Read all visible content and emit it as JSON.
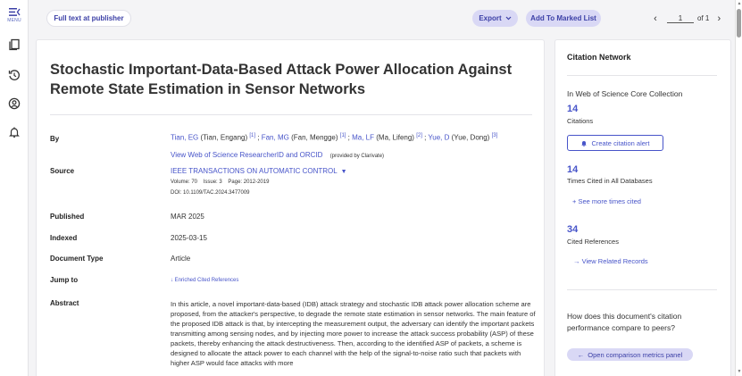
{
  "rail": {
    "menu_label": "MENU"
  },
  "toolbar": {
    "full_text_label": "Full text at publisher",
    "export_label": "Export",
    "marked_list_label": "Add To Marked List",
    "page_current": "1",
    "page_total": "of 1"
  },
  "record": {
    "title": "Stochastic Important-Data-Based Attack Power Allocation Against Remote State Estimation in Sensor Networks",
    "labels": {
      "by": "By",
      "source": "Source",
      "published": "Published",
      "indexed": "Indexed",
      "document_type": "Document Type",
      "jump_to": "Jump to",
      "abstract": "Abstract"
    },
    "authors": [
      {
        "short": "Tian, EG",
        "full": "(Tian, Engang)",
        "ref": "[1]"
      },
      {
        "short": "Fan, MG",
        "full": "(Fan, Mengge)",
        "ref": "[1]"
      },
      {
        "short": "Ma, LF",
        "full": "(Ma, Lifeng)",
        "ref": "[2]"
      },
      {
        "short": "Yue, D",
        "full": "(Yue, Dong)",
        "ref": "[3]"
      }
    ],
    "researcher_link": "View Web of Science ResearcherID and ORCID",
    "provided_by": "(provided by Clarivate)",
    "source_journal": "IEEE TRANSACTIONS ON AUTOMATIC CONTROL",
    "volume": "Volume: 70",
    "issue": "Issue: 3",
    "page": "Page: 2012-2019",
    "doi": "DOI: 10.1109/TAC.2024.3477009",
    "published": "MAR 2025",
    "indexed": "2025-03-15",
    "document_type": "Article",
    "jump_to": "Enriched Cited References",
    "abstract": "In this article, a novel important-data-based (IDB) attack strategy and stochastic IDB attack power allocation scheme are proposed, from the attacker's perspective, to degrade the remote state estimation in sensor networks. The main feature of the proposed IDB attack is that, by intercepting the measurement output, the adversary can identify the important packets transmitting among sensing nodes, and by injecting more power to increase the attack success probability (ASP) of these packets, thereby enhancing the attack destructiveness. Then, according to the identified ASP of packets, a scheme is designed to allocate the attack power to each channel with the help of the signal-to-noise ratio such that packets with higher ASP would face attacks with more"
  },
  "citation_network": {
    "title": "Citation Network",
    "collection": "In Web of Science Core Collection",
    "citations_count": "14",
    "citations_label": "Citations",
    "alert_label": "Create citation alert",
    "times_cited_count": "14",
    "times_cited_label": "Times Cited in All Databases",
    "see_more_label": "See more times cited",
    "cited_refs_count": "34",
    "cited_refs_label": "Cited References",
    "related_label": "View Related Records",
    "compare_question": "How does this document's citation performance compare to peers?",
    "compare_button": "Open comparison metrics panel"
  },
  "colors": {
    "accent": "#4754c9",
    "pill_bg": "#d9d8f5",
    "page_bg": "#f4f4f6"
  }
}
